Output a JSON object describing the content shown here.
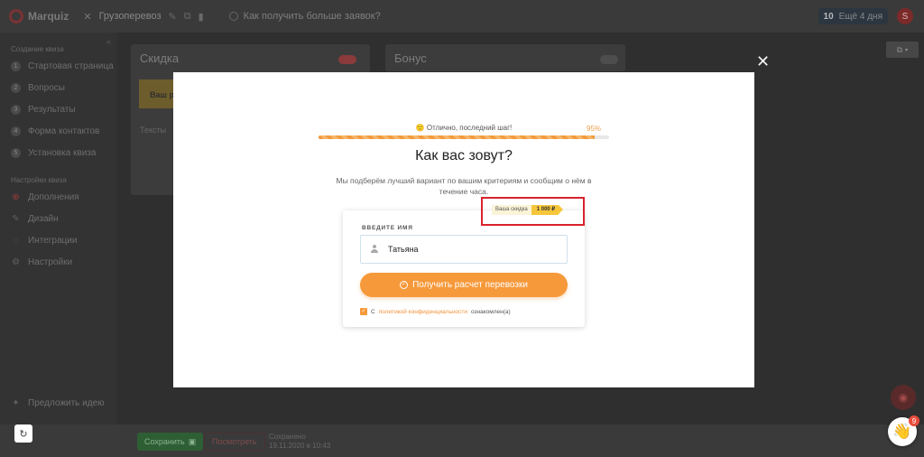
{
  "app": {
    "brand": "Marquiz",
    "project_name": "Грузоперевоз",
    "help_link": "Как получить больше заявок?",
    "leads_count": "10",
    "leads_label": "Ещё 4 дня",
    "user_initial": "S"
  },
  "sidebar": {
    "section_quiz": "Создание квиза",
    "items": [
      {
        "num": "1",
        "label": "Стартовая страница"
      },
      {
        "num": "2",
        "label": "Вопросы"
      },
      {
        "num": "3",
        "label": "Результаты"
      },
      {
        "num": "4",
        "label": "Форма контактов"
      },
      {
        "num": "5",
        "label": "Установка квиза"
      }
    ],
    "section_settings": "Настройки квиза",
    "settings_items": [
      {
        "icon": "plus-icon",
        "label": "Дополнения"
      },
      {
        "icon": "brush-icon",
        "label": "Дизайн"
      },
      {
        "icon": "plug-icon",
        "label": "Интеграции"
      },
      {
        "icon": "gear-icon",
        "label": "Настройки"
      }
    ],
    "suggest": "Предложить идею"
  },
  "background_cards": {
    "card_discount_title": "Скидка",
    "card_discount_box": "Ваш р",
    "card_discount_text": "Тексты",
    "card_bonus_title": "Бонус"
  },
  "bottombar": {
    "save_label": "Сохранить",
    "preview_label": "Посмотреть",
    "saved_line1": "Сохранено",
    "saved_line2": "19.11.2020 в 10:43"
  },
  "chat": {
    "badge": "9"
  },
  "modal": {
    "progress_label": "🙂 Отлично, последний шаг!",
    "progress_pct": "95%",
    "progress_fraction": 0.95,
    "title": "Как вас зовут?",
    "subtitle": "Мы подберём лучший вариант по вашим критериям и сообщим о нём в течение часа.",
    "field_label": "ВВЕДИТЕ ИМЯ",
    "name_value": "Татьяна",
    "submit_label": "Получить расчет перевозки",
    "policy_prefix": "С",
    "policy_link": "политикой конфиденциальности",
    "policy_suffix": "ознакомлен(а)",
    "discount_label": "Ваша скидка",
    "discount_value": "1 000 ₽"
  },
  "colors": {
    "accent": "#f6993b",
    "highlight": "#d9232d",
    "overlay": "#2f2f30"
  }
}
